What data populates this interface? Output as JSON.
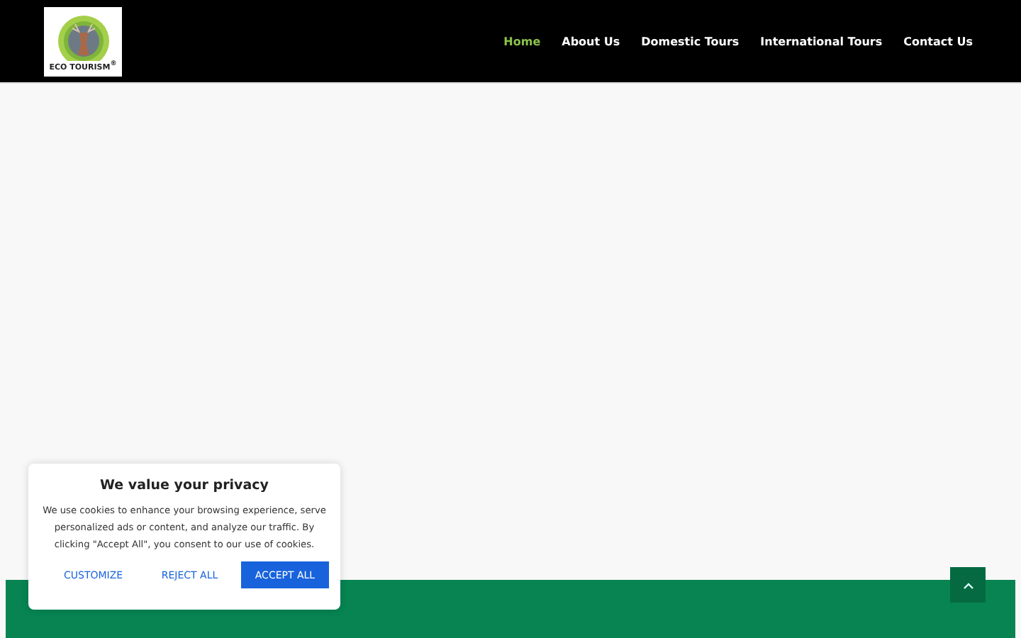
{
  "header": {
    "logo_text": "ECO TOURISM$^{®}$",
    "nav": [
      {
        "label": "Home",
        "selected": true
      },
      {
        "label": "About Us",
        "selected": false
      },
      {
        "label": "Domestic Tours",
        "selected": false
      },
      {
        "label": "International Tours",
        "selected": false
      },
      {
        "label": "Contact Us",
        "selected": false
      }
    ]
  },
  "cookie_banner": {
    "title": "We value your privacy",
    "text": "We use cookies to enhance your browsing experience, serve personalized ads or content, and analyze our traffic. By clicking \"Accept All\", you consent to our use of cookies.",
    "buttons": [
      {
        "label": "CUSTOMIZE",
        "kind": "link"
      },
      {
        "label": "REJECT ALL",
        "kind": "link"
      },
      {
        "label": "ACCEPT ALL",
        "kind": "primary"
      }
    ]
  }
}
